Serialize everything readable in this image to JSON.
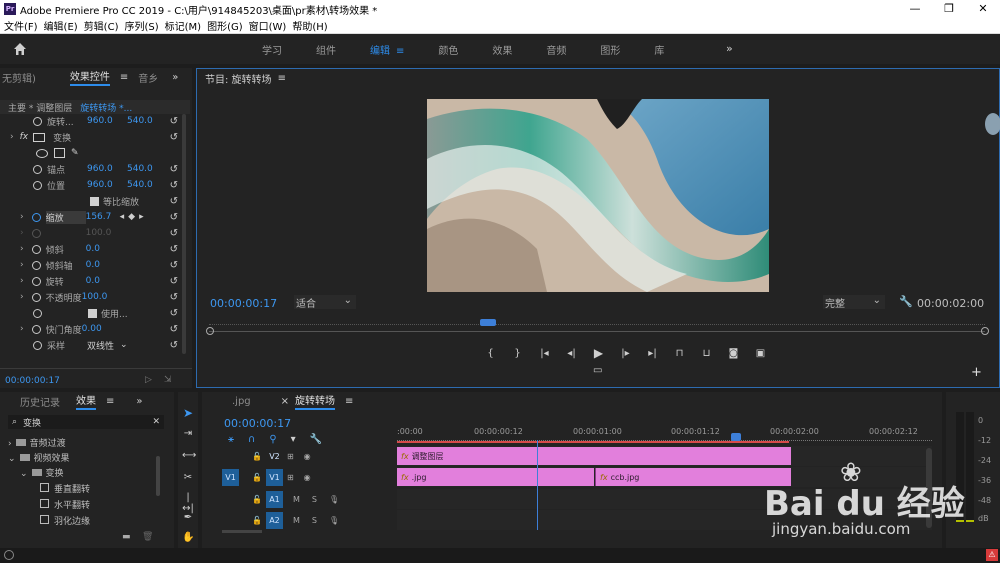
{
  "window": {
    "title": "Adobe Premiere Pro CC 2019 - C:\\用户\\914845203\\桌面\\pr素材\\转场效果 *",
    "logo": "Pr"
  },
  "menu": [
    "文件(F)",
    "编辑(E)",
    "剪辑(C)",
    "序列(S)",
    "标记(M)",
    "图形(G)",
    "窗口(W)",
    "帮助(H)"
  ],
  "workspace": {
    "tabs": [
      {
        "label": "学习",
        "active": false
      },
      {
        "label": "组件",
        "active": false
      },
      {
        "label": "编辑",
        "active": true
      },
      {
        "label": "颜色",
        "active": false
      },
      {
        "label": "效果",
        "active": false
      },
      {
        "label": "音频",
        "active": false
      },
      {
        "label": "图形",
        "active": false
      },
      {
        "label": "库",
        "active": false
      }
    ],
    "menu_glyph": "≡",
    "more_glyph": "»"
  },
  "effect_controls": {
    "tabs": [
      "无剪辑)",
      "效果控件",
      "音乡"
    ],
    "menu_glyph": "≡",
    "subheader": {
      "source": "主要 * 调整图层",
      "sequence": "旋转转场 *..."
    },
    "rows": [
      {
        "label": "旋转...",
        "v1": "960.0",
        "v2": "540.0"
      },
      {
        "label": "变换",
        "v1": "",
        "v2": ""
      },
      {
        "label": "锚点",
        "v1": "960.0",
        "v2": "540.0"
      },
      {
        "label": "位置",
        "v1": "960.0",
        "v2": "540.0"
      },
      {
        "label": "等比缩放",
        "v1": "",
        "v2": ""
      },
      {
        "label": "缩放",
        "v1": "156.7",
        "v2": ""
      },
      {
        "label": "",
        "v1": "100.0",
        "v2": ""
      },
      {
        "label": "倾斜",
        "v1": "0.0",
        "v2": ""
      },
      {
        "label": "倾斜轴",
        "v1": "0.0",
        "v2": ""
      },
      {
        "label": "旋转",
        "v1": "0.0",
        "v2": ""
      },
      {
        "label": "不透明度",
        "v1": "100.0",
        "v2": ""
      },
      {
        "label": "使用...",
        "v1": "",
        "v2": ""
      },
      {
        "label": "快门角度",
        "v1": "0.00",
        "v2": ""
      },
      {
        "label": "采样",
        "v1": "双线性",
        "v2": ""
      }
    ],
    "fx_label": "fx",
    "timecode": "00:00:00:17"
  },
  "program_monitor": {
    "title": "节目: 旋转转场",
    "timecode": "00:00:00:17",
    "fit": "适合",
    "quality": "完整",
    "duration": "00:00:02:00",
    "playhead_fraction": 0.36
  },
  "effects_panel": {
    "tabs": [
      "历史记录",
      "效果"
    ],
    "search_value": "变换",
    "tree": [
      {
        "label": "音频过渡",
        "depth": 0
      },
      {
        "label": "视频效果",
        "depth": 0
      },
      {
        "label": "变换",
        "depth": 1
      },
      {
        "label": "垂直翻转",
        "depth": 2
      },
      {
        "label": "水平翻转",
        "depth": 2
      },
      {
        "label": "羽化边缘",
        "depth": 2
      }
    ]
  },
  "timeline": {
    "tab_prev": ".jpg",
    "tab_active": "旋转转场",
    "timecode": "00:00:00:17",
    "ruler": [
      ":00:00",
      "00:00:00:12",
      "00:00:01:00",
      "00:00:01:12",
      "00:00:02:00",
      "00:00:02:12"
    ],
    "tracks": [
      {
        "src": "",
        "label": "V2"
      },
      {
        "src": "V1",
        "label": "V1"
      },
      {
        "src": "",
        "label": "A1"
      },
      {
        "src": "",
        "label": "A2"
      }
    ],
    "clips": [
      {
        "track": "V2",
        "label": "调整图层"
      },
      {
        "track": "V1",
        "label": ".jpg"
      },
      {
        "track": "V1",
        "label": "ccb.jpg"
      }
    ],
    "toggles": {
      "mute": "M",
      "solo": "S"
    }
  },
  "audio_meter": {
    "scale": [
      "0",
      "-12",
      "-24",
      "-36",
      "-48",
      "dB"
    ]
  },
  "watermark": {
    "main": "Bai du 经验",
    "url": "jingyan.baidu.com"
  },
  "colors": {
    "accent": "#2d8ceb",
    "clip": "#e27fdc",
    "track_label": "#1e5f99"
  }
}
